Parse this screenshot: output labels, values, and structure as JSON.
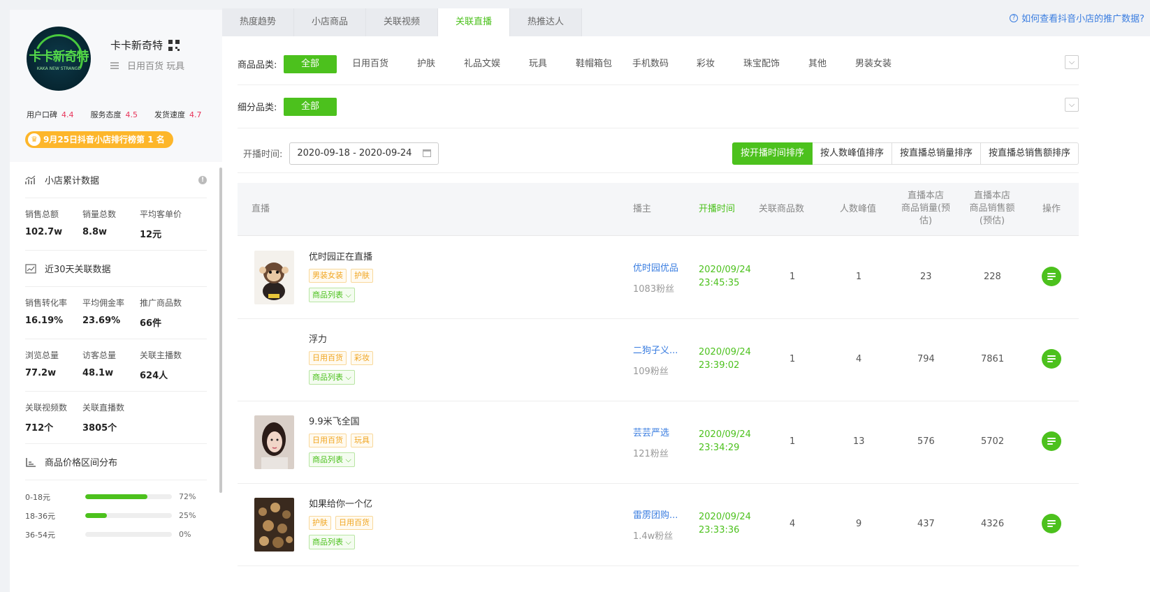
{
  "shop": {
    "name": "卡卡新奇特",
    "logo_text": "卡卡新奇特",
    "logo_sub": "KAKA NEW STRANGE",
    "categories": "日用百货 玩具",
    "ratings": [
      {
        "label": "用户口碑",
        "value": "4.4"
      },
      {
        "label": "服务态度",
        "value": "4.5"
      },
      {
        "label": "发货速度",
        "value": "4.7"
      }
    ],
    "rank_badge": "9月25日抖音小店排行榜第 1 名"
  },
  "stats": {
    "cumulative_title": "小店累计数据",
    "row1": [
      {
        "label": "销售总额",
        "value": "102.7w"
      },
      {
        "label": "销量总数",
        "value": "8.8w"
      },
      {
        "label": "平均客单价",
        "value": "12元"
      }
    ],
    "recent_title": "近30天关联数据",
    "row2": [
      {
        "label": "销售转化率",
        "value": "16.19%"
      },
      {
        "label": "平均佣金率",
        "value": "23.69%"
      },
      {
        "label": "推广商品数",
        "value": "66件"
      }
    ],
    "row3": [
      {
        "label": "浏览总量",
        "value": "77.2w"
      },
      {
        "label": "访客总量",
        "value": "48.1w"
      },
      {
        "label": "关联主播数",
        "value": "624人"
      }
    ],
    "row4": [
      {
        "label": "关联视频数",
        "value": "712个"
      },
      {
        "label": "关联直播数",
        "value": "3805个"
      }
    ],
    "price_title": "商品价格区间分布",
    "price_dist": [
      {
        "range": "0-18元",
        "pct": "72%",
        "value": 72
      },
      {
        "range": "18-36元",
        "pct": "25%",
        "value": 25
      },
      {
        "range": "36-54元",
        "pct": "0%",
        "value": 0
      }
    ]
  },
  "tabs": [
    {
      "label": "热度趋势"
    },
    {
      "label": "小店商品"
    },
    {
      "label": "关联视频"
    },
    {
      "label": "关联直播",
      "active": true
    },
    {
      "label": "热推达人"
    }
  ],
  "help_link": "如何查看抖音小店的推广数据?",
  "filters": {
    "category_label": "商品品类:",
    "categories": [
      "全部",
      "日用百货",
      "护肤",
      "礼品文娱",
      "玩具",
      "鞋帽箱包",
      "手机数码",
      "彩妆",
      "珠宝配饰",
      "其他",
      "男装女装"
    ],
    "subcategory_label": "细分品类:",
    "subcategories": [
      "全部"
    ]
  },
  "date": {
    "label": "开播时间:",
    "value": "2020-09-18 - 2020-09-24"
  },
  "sort_buttons": [
    "按开播时间排序",
    "按人数峰值排序",
    "按直播总销量排序",
    "按直播总销售额排序"
  ],
  "table": {
    "headers": {
      "live": "直播",
      "anchor": "播主",
      "start_time": "开播时间",
      "product_count": "关联商品数",
      "peak": "人数峰值",
      "sales_1": "直播本店",
      "sales_2": "商品销量(预",
      "sales_3": "估)",
      "amount_1": "直播本店",
      "amount_2": "商品销售额",
      "amount_3": "(预估)",
      "op": "操作"
    },
    "rows": [
      {
        "title": "优时园正在直播",
        "tags": [
          "男装女装",
          "护肤"
        ],
        "plist": "商品列表",
        "anchor": "优时园优品",
        "fans": "1083粉丝",
        "date": "2020/09/24",
        "time": "23:45:35",
        "products": "1",
        "peak": "1",
        "sales": "23",
        "amount": "228"
      },
      {
        "title": "浮力",
        "tags": [
          "日用百货",
          "彩妆"
        ],
        "plist": "商品列表",
        "anchor": "二狗子义...",
        "fans": "109粉丝",
        "date": "2020/09/24",
        "time": "23:39:02",
        "products": "1",
        "peak": "4",
        "sales": "794",
        "amount": "7861"
      },
      {
        "title": "9.9米飞全国",
        "tags": [
          "日用百货",
          "玩具"
        ],
        "plist": "商品列表",
        "anchor": "芸芸严选",
        "fans": "121粉丝",
        "date": "2020/09/24",
        "time": "23:34:29",
        "products": "1",
        "peak": "13",
        "sales": "576",
        "amount": "5702"
      },
      {
        "title": "如果给你一个亿",
        "tags": [
          "护肤",
          "日用百货"
        ],
        "plist": "商品列表",
        "anchor": "雷雳团购...",
        "fans": "1.4w粉丝",
        "date": "2020/09/24",
        "time": "23:33:36",
        "products": "4",
        "peak": "9",
        "sales": "437",
        "amount": "4326"
      }
    ]
  },
  "colors": {
    "accent": "#4cc11d",
    "link": "#3a7de0",
    "rating": "#e8345a",
    "badge": "#fdb62a",
    "tag": "#f0a520"
  }
}
